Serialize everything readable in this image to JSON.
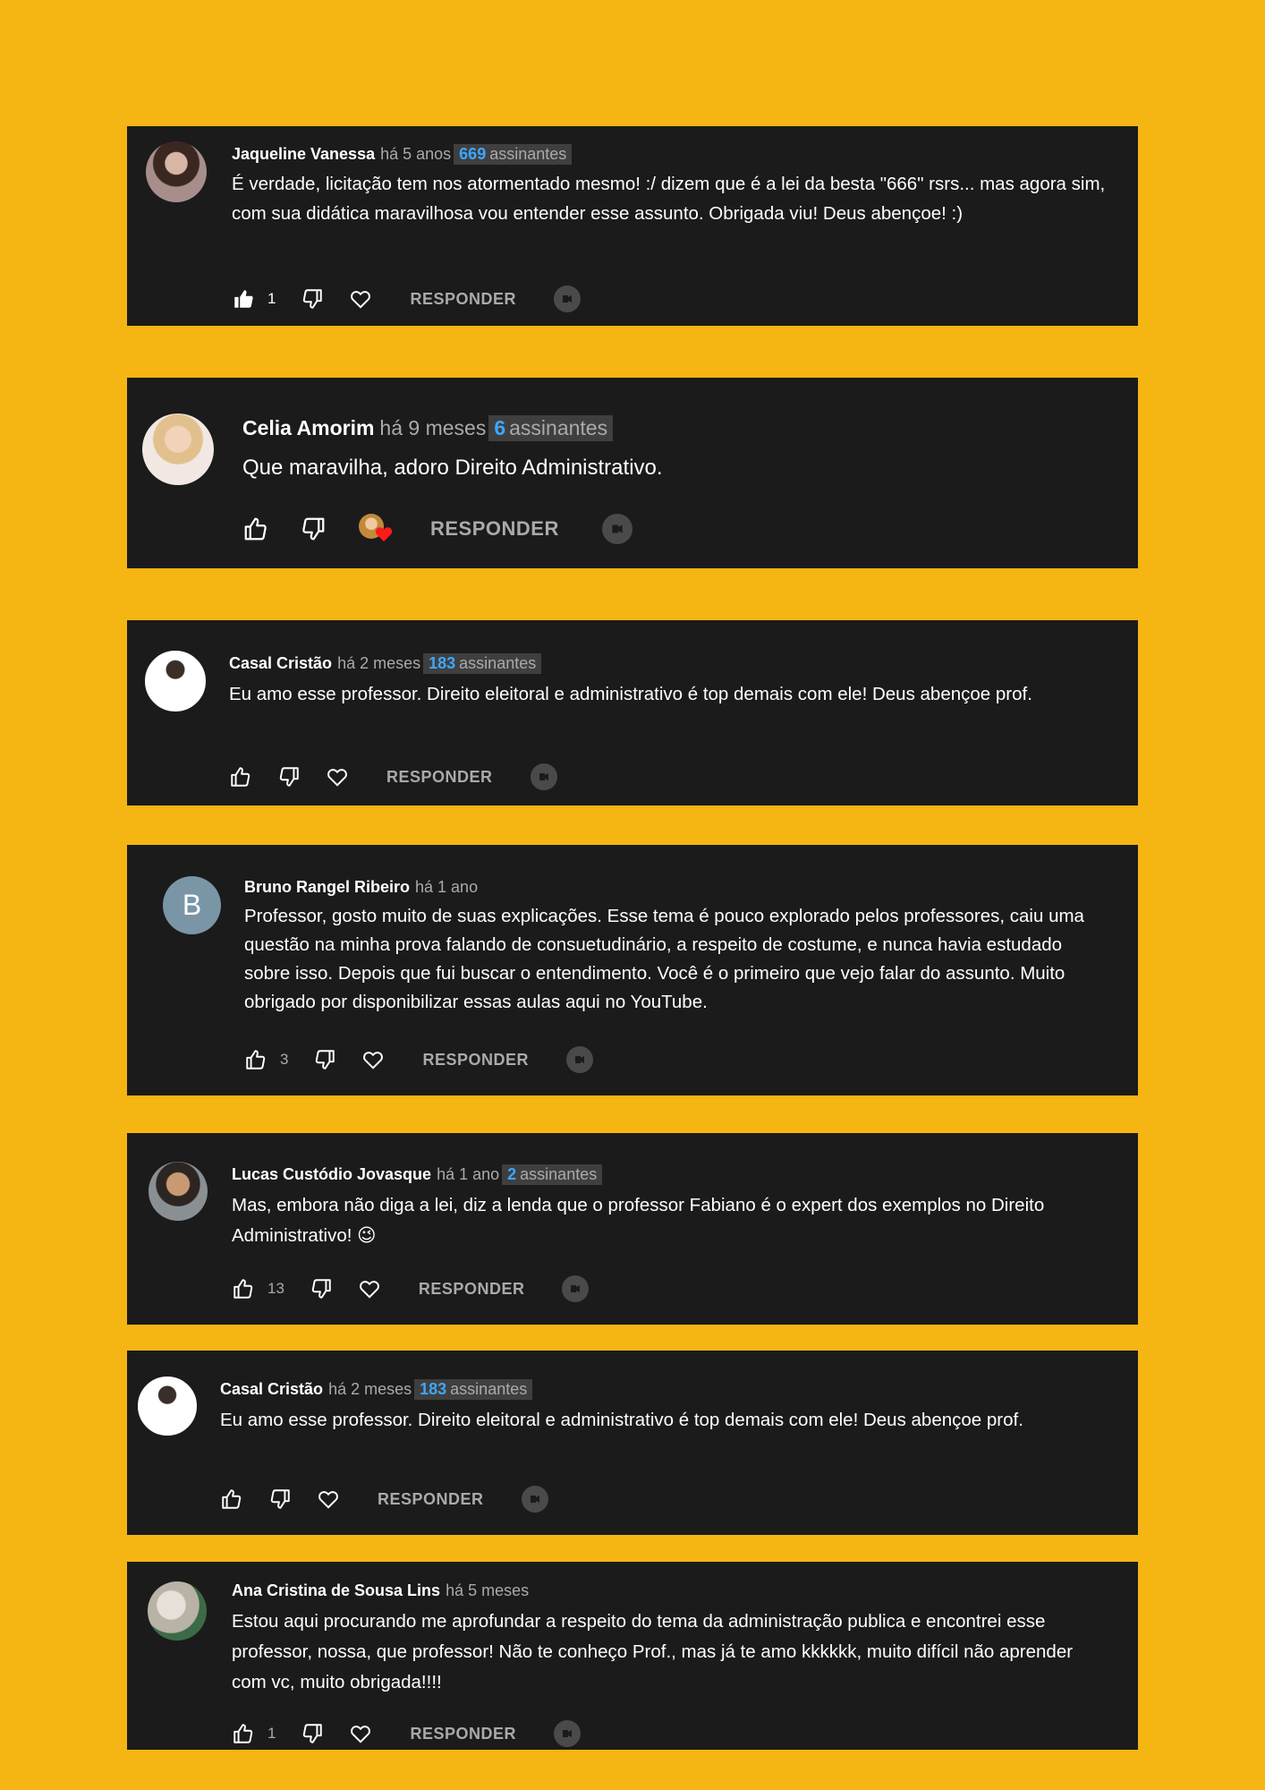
{
  "reply_label": "RESPONDER",
  "colors": {
    "page_background": "#F5B512",
    "card_background": "#1b1b1b",
    "author_text": "#ffffff",
    "secondary_text": "#aaaaaa",
    "subscriber_count": "#3ea6ff"
  },
  "icons": [
    "thumbs-up-icon",
    "thumbs-down-icon",
    "heart-icon",
    "creator-heart-icon",
    "video-reply-icon"
  ],
  "comments": [
    {
      "author": "Jaqueline Vanessa",
      "time": "há 5 anos",
      "subscribers_count": "669",
      "subscribers_label": "assinantes",
      "text": "É verdade, licitação tem nos atormentado mesmo! :/ dizem que é a lei da besta \"666\" rsrs... mas agora sim, com sua didática maravilhosa vou entender esse assunto. Obrigada viu! Deus abençoe! :)",
      "likes": "1",
      "liked": true
    },
    {
      "author": "Celia Amorim",
      "time": "há 9 meses",
      "subscribers_count": "6",
      "subscribers_label": "assinantes",
      "text": "Que maravilha, adoro Direito Administrativo.",
      "likes": "",
      "creator_heart": true
    },
    {
      "author": "Casal Cristão",
      "time": "há 2 meses",
      "subscribers_count": "183",
      "subscribers_label": "assinantes",
      "text": "Eu amo esse professor. Direito eleitoral e administrativo é top demais com ele! Deus abençoe prof.",
      "likes": ""
    },
    {
      "author": "Bruno Rangel Ribeiro",
      "time": "há 1 ano",
      "avatar_letter": "B",
      "text": "Professor, gosto muito de suas explicações. Esse tema é pouco explorado pelos professores, caiu uma questão na minha prova falando de consuetudinário, a respeito de costume, e nunca havia estudado sobre isso. Depois que fui buscar o entendimento. Você é o primeiro que vejo falar do assunto. Muito obrigado por disponibilizar essas aulas aqui no YouTube.",
      "likes": "3"
    },
    {
      "author": "Lucas Custódio Jovasque",
      "time": "há 1 ano",
      "subscribers_count": "2",
      "subscribers_label": "assinantes",
      "text": "Mas, embora não diga a lei, diz a lenda que o professor Fabiano é o expert dos exemplos no Direito Administrativo! 😉",
      "likes": "13"
    },
    {
      "author": "Casal Cristão",
      "time": "há 2 meses",
      "subscribers_count": "183",
      "subscribers_label": "assinantes",
      "text": "Eu amo esse professor. Direito eleitoral e administrativo é top demais com ele! Deus abençoe prof.",
      "likes": ""
    },
    {
      "author": "Ana Cristina de Sousa Lins",
      "time": "há 5 meses",
      "text": "Estou aqui procurando me aprofundar a respeito do tema da administração publica e encontrei esse professor, nossa, que professor! Não te conheço Prof., mas já te amo kkkkkk, muito difícil não aprender com vc, muito obrigada!!!!",
      "likes": "1"
    }
  ]
}
